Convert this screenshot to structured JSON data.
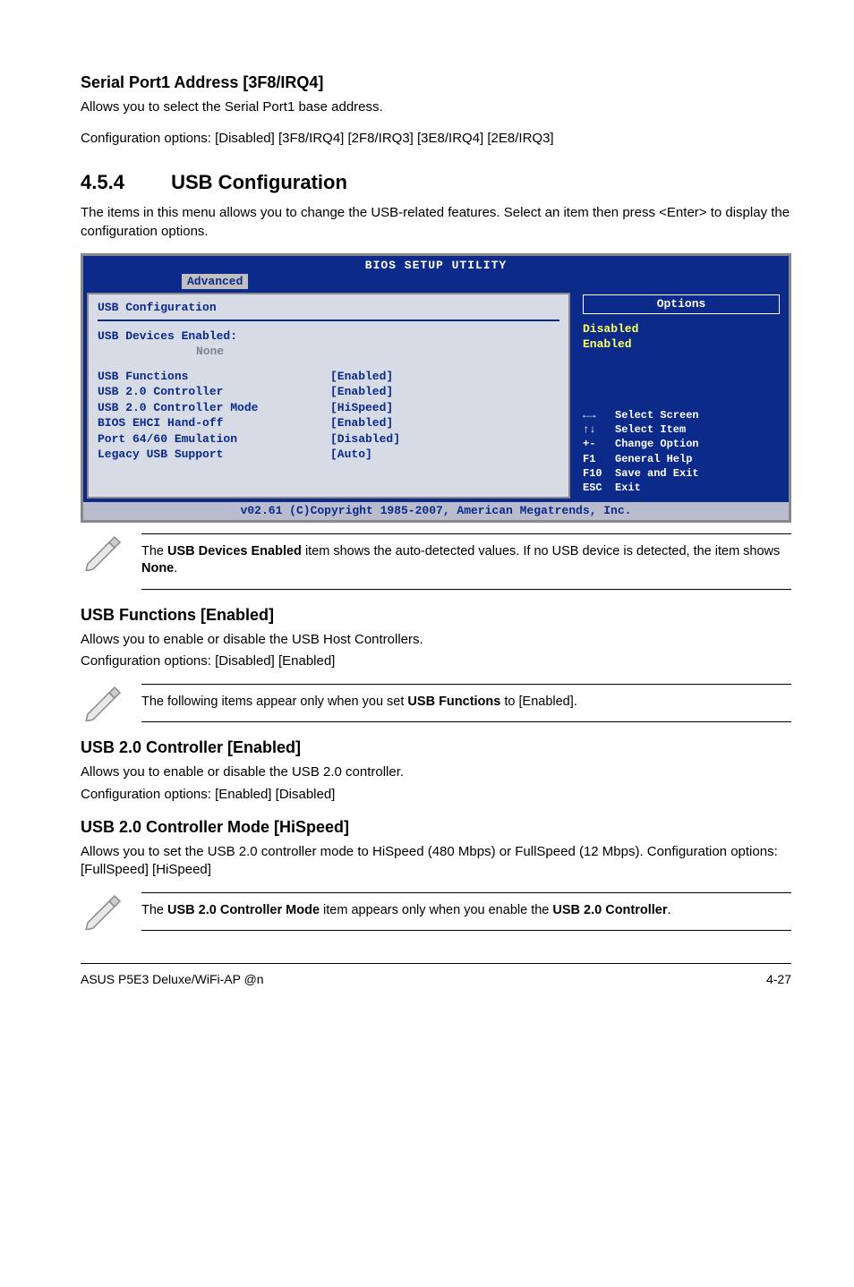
{
  "section1": {
    "heading": "Serial Port1 Address [3F8/IRQ4]",
    "p1": "Allows you to select the Serial Port1 base address.",
    "p2": "Configuration options: [Disabled] [3F8/IRQ4] [2F8/IRQ3] [3E8/IRQ4] [2E8/IRQ3]"
  },
  "section2": {
    "num": "4.5.4",
    "title": "USB Configuration",
    "p": "The items in this menu allows you to change the USB-related features. Select an item then press <Enter> to display the configuration options."
  },
  "bios": {
    "title": "BIOS SETUP UTILITY",
    "tab": "Advanced",
    "header": "USB Configuration",
    "devices_lbl": "USB Devices Enabled:",
    "devices_val": "None",
    "rows": [
      {
        "lbl": "USB Functions",
        "val": "[Enabled]"
      },
      {
        "lbl": "USB 2.0 Controller",
        "val": "[Enabled]"
      },
      {
        "lbl": "USB 2.0 Controller Mode",
        "val": "[HiSpeed]"
      },
      {
        "lbl": "BIOS EHCI Hand-off",
        "val": "[Enabled]"
      },
      {
        "lbl": "Port 64/60 Emulation",
        "val": "[Disabled]"
      },
      {
        "lbl": "Legacy USB Support",
        "val": "[Auto]"
      }
    ],
    "options_title": "Options",
    "opt1": "Disabled",
    "opt2": "Enabled",
    "nav": [
      {
        "k": "←→",
        "t": "Select Screen"
      },
      {
        "k": "↑↓",
        "t": "Select Item"
      },
      {
        "k": "+-",
        "t": "Change Option"
      },
      {
        "k": "F1",
        "t": "General Help"
      },
      {
        "k": "F10",
        "t": "Save and Exit"
      },
      {
        "k": "ESC",
        "t": "Exit"
      }
    ],
    "footer": "v02.61 (C)Copyright 1985-2007, American Megatrends, Inc."
  },
  "note1": {
    "t1": "The ",
    "b1": "USB Devices Enabled",
    "t2": " item shows the auto-detected values. If no USB device is detected, the item shows ",
    "b2": "None",
    "t3": "."
  },
  "sec_usb_func": {
    "h": "USB Functions [Enabled]",
    "p1": "Allows you to enable or disable the USB Host Controllers.",
    "p2": "Configuration options: [Disabled] [Enabled]"
  },
  "note2": {
    "t1": "The following items appear only when you set ",
    "b1": "USB Functions",
    "t2": " to [Enabled]."
  },
  "sec_ctrl": {
    "h": "USB 2.0 Controller [Enabled]",
    "p1": "Allows you to enable or disable the USB 2.0 controller.",
    "p2": "Configuration options: [Enabled] [Disabled]"
  },
  "sec_mode": {
    "h": "USB 2.0 Controller Mode [HiSpeed]",
    "p": "Allows you to set the USB 2.0 controller mode to HiSpeed (480 Mbps) or FullSpeed (12 Mbps). Configuration options: [FullSpeed] [HiSpeed]"
  },
  "note3": {
    "t1": "The ",
    "b1": "USB 2.0 Controller Mode",
    "t2": " item appears only when you enable the ",
    "b2": "USB 2.0 Controller",
    "t3": "."
  },
  "footer": {
    "left": "ASUS P5E3 Deluxe/WiFi-AP @n",
    "right": "4-27"
  }
}
